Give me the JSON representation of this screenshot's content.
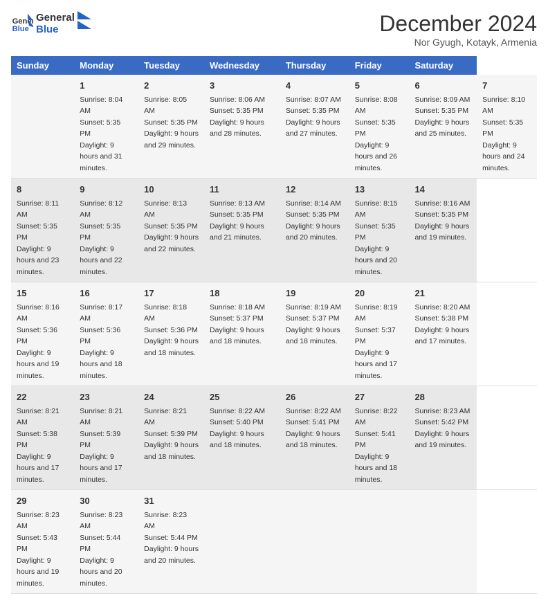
{
  "header": {
    "logo_line1": "General",
    "logo_line2": "Blue",
    "title": "December 2024",
    "subtitle": "Nor Gyugh, Kotayk, Armenia"
  },
  "calendar": {
    "days_of_week": [
      "Sunday",
      "Monday",
      "Tuesday",
      "Wednesday",
      "Thursday",
      "Friday",
      "Saturday"
    ],
    "weeks": [
      [
        null,
        {
          "day": 1,
          "sunrise": "8:04 AM",
          "sunset": "5:35 PM",
          "daylight": "9 hours and 31 minutes."
        },
        {
          "day": 2,
          "sunrise": "8:05 AM",
          "sunset": "5:35 PM",
          "daylight": "9 hours and 29 minutes."
        },
        {
          "day": 3,
          "sunrise": "8:06 AM",
          "sunset": "5:35 PM",
          "daylight": "9 hours and 28 minutes."
        },
        {
          "day": 4,
          "sunrise": "8:07 AM",
          "sunset": "5:35 PM",
          "daylight": "9 hours and 27 minutes."
        },
        {
          "day": 5,
          "sunrise": "8:08 AM",
          "sunset": "5:35 PM",
          "daylight": "9 hours and 26 minutes."
        },
        {
          "day": 6,
          "sunrise": "8:09 AM",
          "sunset": "5:35 PM",
          "daylight": "9 hours and 25 minutes."
        },
        {
          "day": 7,
          "sunrise": "8:10 AM",
          "sunset": "5:35 PM",
          "daylight": "9 hours and 24 minutes."
        }
      ],
      [
        {
          "day": 8,
          "sunrise": "8:11 AM",
          "sunset": "5:35 PM",
          "daylight": "9 hours and 23 minutes."
        },
        {
          "day": 9,
          "sunrise": "8:12 AM",
          "sunset": "5:35 PM",
          "daylight": "9 hours and 22 minutes."
        },
        {
          "day": 10,
          "sunrise": "8:13 AM",
          "sunset": "5:35 PM",
          "daylight": "9 hours and 22 minutes."
        },
        {
          "day": 11,
          "sunrise": "8:13 AM",
          "sunset": "5:35 PM",
          "daylight": "9 hours and 21 minutes."
        },
        {
          "day": 12,
          "sunrise": "8:14 AM",
          "sunset": "5:35 PM",
          "daylight": "9 hours and 20 minutes."
        },
        {
          "day": 13,
          "sunrise": "8:15 AM",
          "sunset": "5:35 PM",
          "daylight": "9 hours and 20 minutes."
        },
        {
          "day": 14,
          "sunrise": "8:16 AM",
          "sunset": "5:35 PM",
          "daylight": "9 hours and 19 minutes."
        }
      ],
      [
        {
          "day": 15,
          "sunrise": "8:16 AM",
          "sunset": "5:36 PM",
          "daylight": "9 hours and 19 minutes."
        },
        {
          "day": 16,
          "sunrise": "8:17 AM",
          "sunset": "5:36 PM",
          "daylight": "9 hours and 18 minutes."
        },
        {
          "day": 17,
          "sunrise": "8:18 AM",
          "sunset": "5:36 PM",
          "daylight": "9 hours and 18 minutes."
        },
        {
          "day": 18,
          "sunrise": "8:18 AM",
          "sunset": "5:37 PM",
          "daylight": "9 hours and 18 minutes."
        },
        {
          "day": 19,
          "sunrise": "8:19 AM",
          "sunset": "5:37 PM",
          "daylight": "9 hours and 18 minutes."
        },
        {
          "day": 20,
          "sunrise": "8:19 AM",
          "sunset": "5:37 PM",
          "daylight": "9 hours and 17 minutes."
        },
        {
          "day": 21,
          "sunrise": "8:20 AM",
          "sunset": "5:38 PM",
          "daylight": "9 hours and 17 minutes."
        }
      ],
      [
        {
          "day": 22,
          "sunrise": "8:21 AM",
          "sunset": "5:38 PM",
          "daylight": "9 hours and 17 minutes."
        },
        {
          "day": 23,
          "sunrise": "8:21 AM",
          "sunset": "5:39 PM",
          "daylight": "9 hours and 17 minutes."
        },
        {
          "day": 24,
          "sunrise": "8:21 AM",
          "sunset": "5:39 PM",
          "daylight": "9 hours and 18 minutes."
        },
        {
          "day": 25,
          "sunrise": "8:22 AM",
          "sunset": "5:40 PM",
          "daylight": "9 hours and 18 minutes."
        },
        {
          "day": 26,
          "sunrise": "8:22 AM",
          "sunset": "5:41 PM",
          "daylight": "9 hours and 18 minutes."
        },
        {
          "day": 27,
          "sunrise": "8:22 AM",
          "sunset": "5:41 PM",
          "daylight": "9 hours and 18 minutes."
        },
        {
          "day": 28,
          "sunrise": "8:23 AM",
          "sunset": "5:42 PM",
          "daylight": "9 hours and 19 minutes."
        }
      ],
      [
        {
          "day": 29,
          "sunrise": "8:23 AM",
          "sunset": "5:43 PM",
          "daylight": "9 hours and 19 minutes."
        },
        {
          "day": 30,
          "sunrise": "8:23 AM",
          "sunset": "5:44 PM",
          "daylight": "9 hours and 20 minutes."
        },
        {
          "day": 31,
          "sunrise": "8:23 AM",
          "sunset": "5:44 PM",
          "daylight": "9 hours and 20 minutes."
        },
        null,
        null,
        null,
        null
      ]
    ]
  }
}
